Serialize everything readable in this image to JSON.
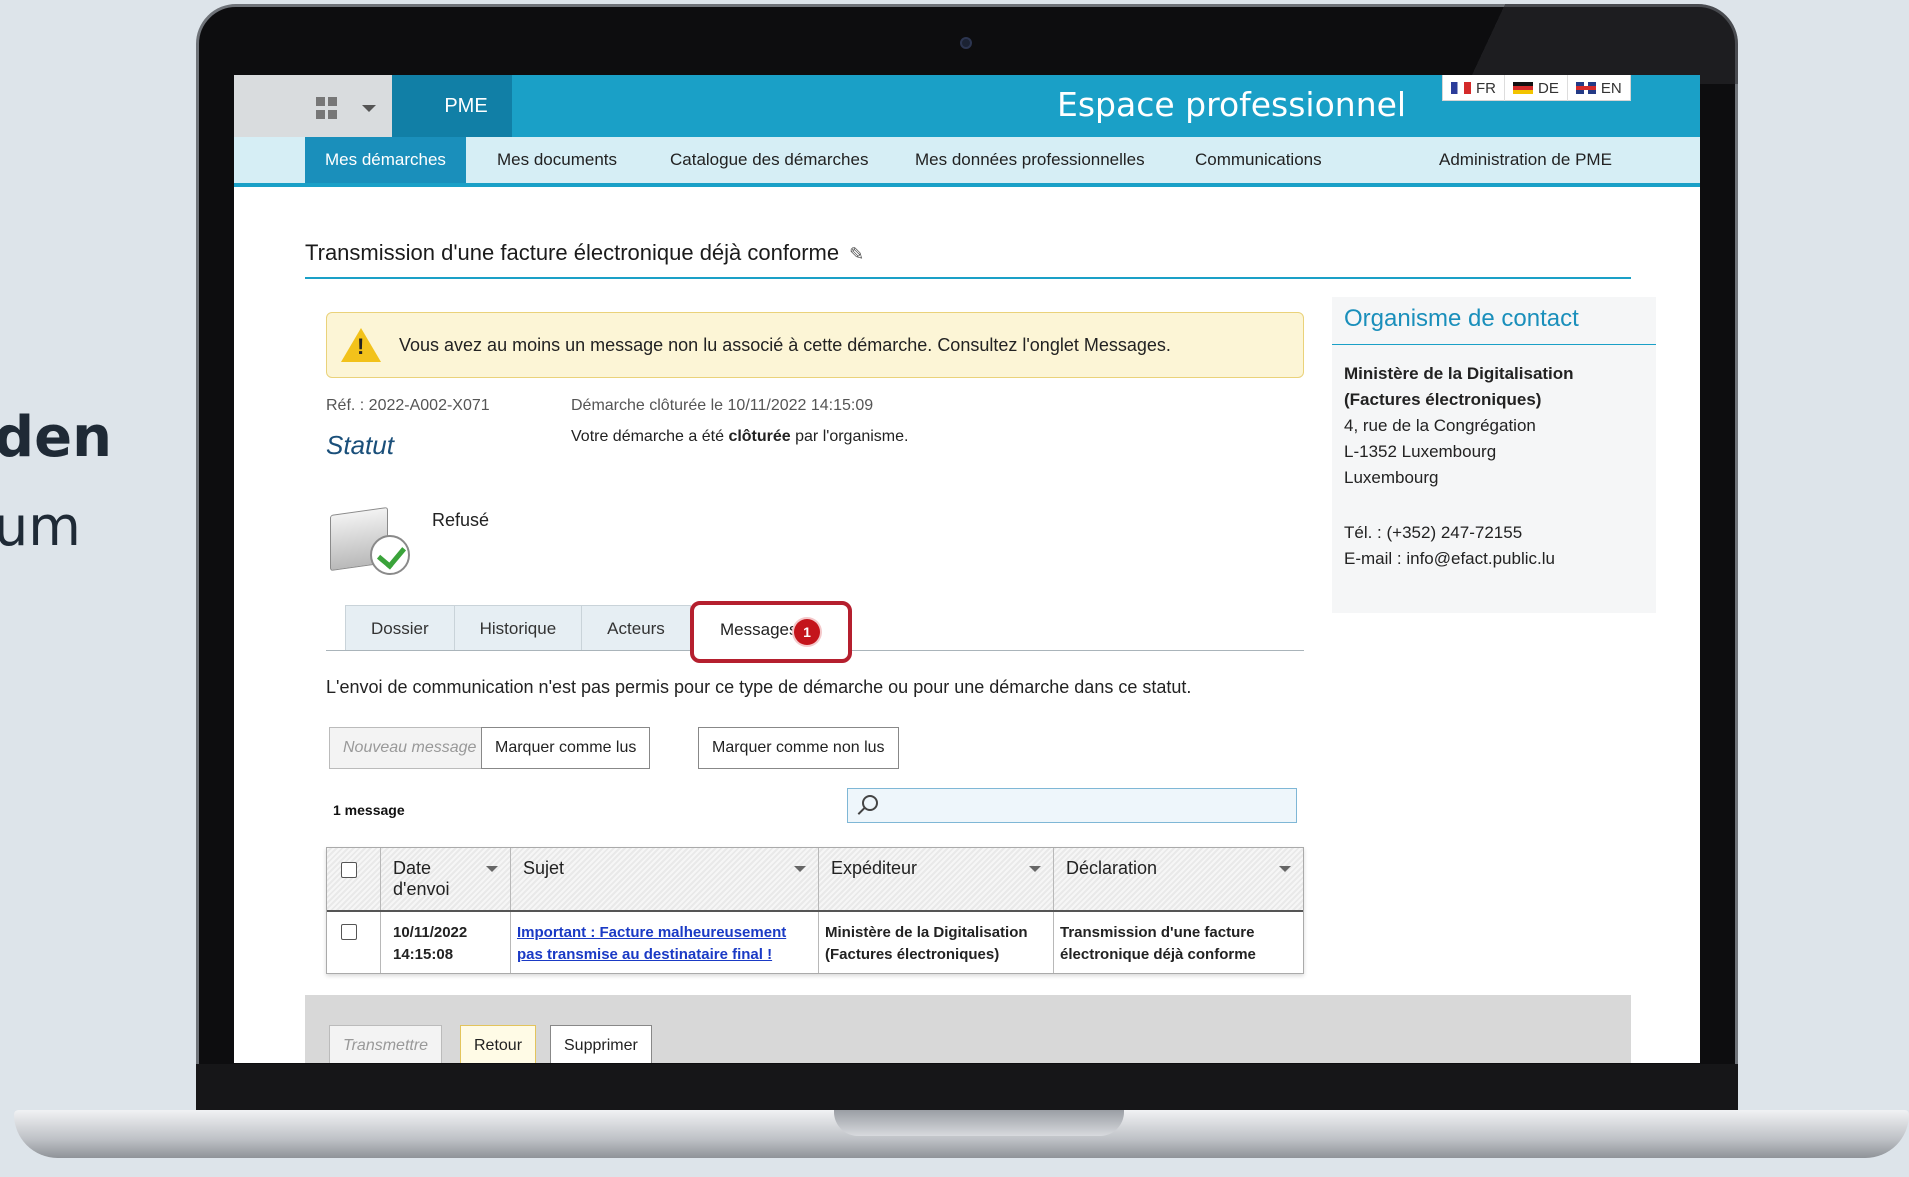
{
  "side_text": {
    "line1": "den",
    "line2": "um"
  },
  "header": {
    "app_label": "PME",
    "site_title": "Espace professionnel",
    "languages": [
      "FR",
      "DE",
      "EN"
    ]
  },
  "nav": {
    "items": [
      "Mes démarches",
      "Mes documents",
      "Catalogue des démarches",
      "Mes données professionnelles",
      "Communications",
      "Administration de PME"
    ]
  },
  "page": {
    "title": "Transmission d'une facture électronique déjà conforme",
    "alert": "Vous avez au moins un message non lu associé à cette démarche. Consultez l'onglet Messages.",
    "reference": "Réf. : 2022-A002-X071",
    "closed_line": "Démarche clôturée le 10/11/2022 14:15:09",
    "closed_msg_pre": "Votre démarche a été ",
    "closed_msg_bold": "clôturée",
    "closed_msg_post": " par l'organisme.",
    "statut_label": "Statut",
    "status_value": "Refusé"
  },
  "tabs": {
    "items": [
      "Dossier",
      "Historique",
      "Acteurs"
    ],
    "active": "Messages",
    "badge": "1"
  },
  "messages": {
    "notice": "L'envoi de communication n'est pas permis pour ce type de démarche ou pour une démarche dans ce statut.",
    "buttons": {
      "new": "Nouveau message",
      "mark_read": "Marquer comme lus",
      "mark_unread": "Marquer comme non lus"
    },
    "count": "1 message",
    "columns": [
      "Date d'envoi",
      "Sujet",
      "Expéditeur",
      "Déclaration"
    ],
    "rows": [
      {
        "date": "10/11/2022 14:15:08",
        "subject": "Important : Facture malheureusement pas transmise au destinataire final !",
        "sender": "Ministère de la Digitalisation (Factures électroniques)",
        "declaration": "Transmission d'une facture électronique déjà conforme"
      }
    ]
  },
  "contact": {
    "heading": "Organisme de contact",
    "org_line1": "Ministère de la Digitalisation",
    "org_line2": "(Factures électroniques)",
    "address1": "4, rue de la Congrégation",
    "address2": "L-1352 Luxembourg",
    "country": "Luxembourg",
    "phone": "Tél. : (+352) 247-72155",
    "email": "E-mail : info@efact.public.lu"
  },
  "footer": {
    "transmit": "Transmettre",
    "back": "Retour",
    "delete": "Supprimer"
  },
  "colors": {
    "header_blue": "#1aa0c7",
    "nav_bg": "#d6eef5",
    "highlight_red": "#b51f2e",
    "link_blue": "#1a3ac5"
  }
}
